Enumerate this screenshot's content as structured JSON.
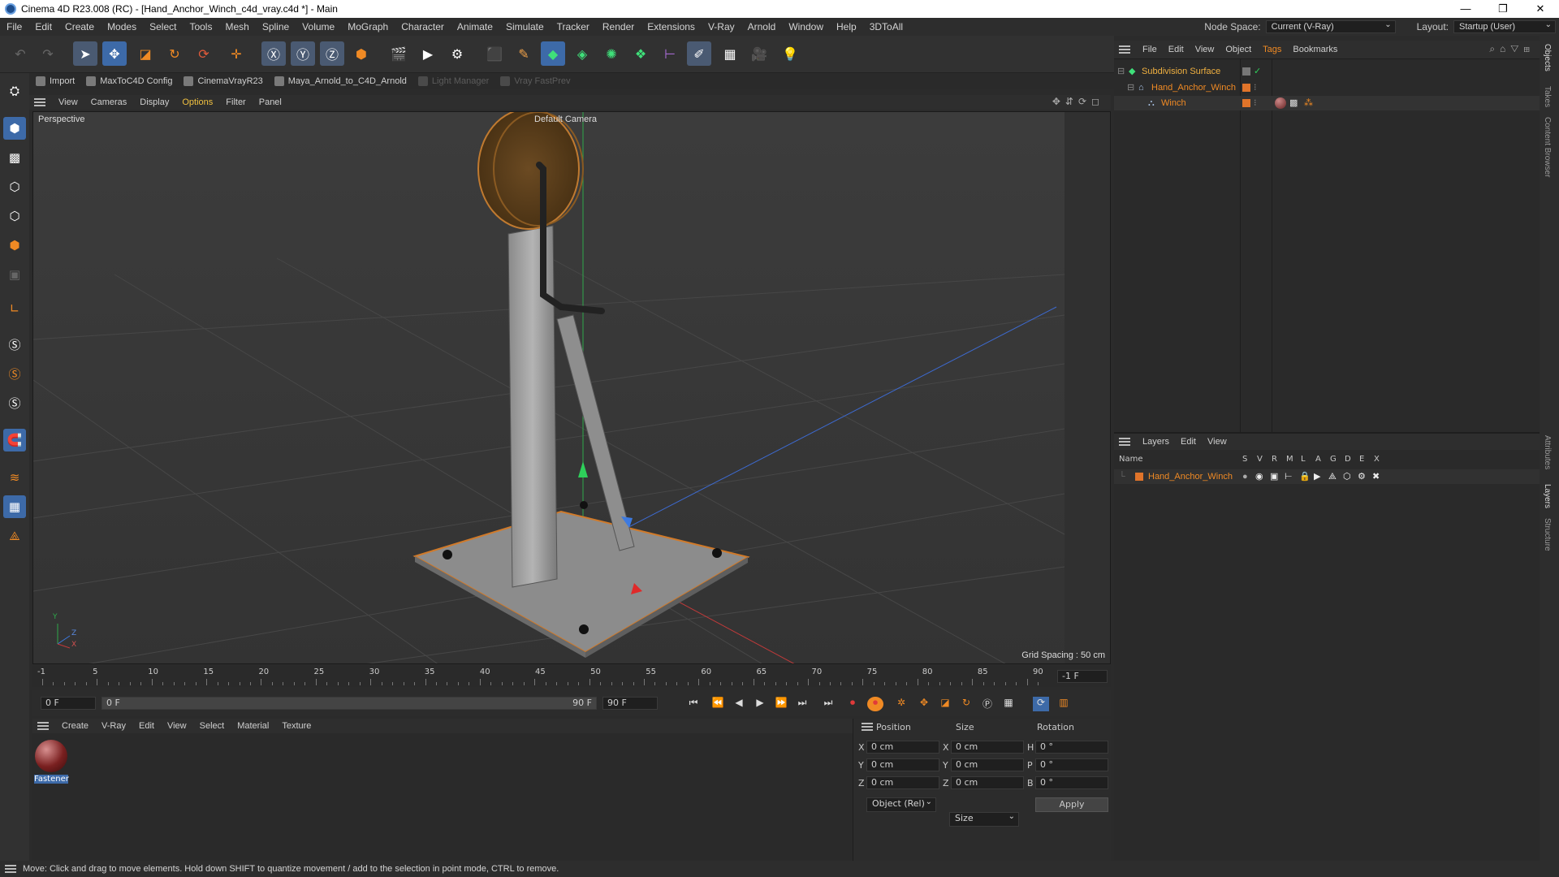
{
  "window": {
    "title": "Cinema 4D R23.008 (RC) - [Hand_Anchor_Winch_c4d_vray.c4d *] - Main",
    "controls": [
      "—",
      "❐",
      "✕"
    ]
  },
  "menubar": {
    "items": [
      "File",
      "Edit",
      "Create",
      "Modes",
      "Select",
      "Tools",
      "Mesh",
      "Spline",
      "Volume",
      "MoGraph",
      "Character",
      "Animate",
      "Simulate",
      "Tracker",
      "Render",
      "Extensions",
      "V-Ray",
      "Arnold",
      "Window",
      "Help",
      "3DToAll"
    ],
    "node_space_label": "Node Space:",
    "node_space_value": "Current (V-Ray)",
    "layout_label": "Layout:",
    "layout_value": "Startup (User)"
  },
  "pluginbar": {
    "items": [
      {
        "label": "Import",
        "enabled": true
      },
      {
        "label": "MaxToC4D Config",
        "enabled": true
      },
      {
        "label": "CinemaVrayR23",
        "enabled": true
      },
      {
        "label": "Maya_Arnold_to_C4D_Arnold",
        "enabled": true
      },
      {
        "label": "Light Manager",
        "enabled": false
      },
      {
        "label": "Vray FastPrev",
        "enabled": false
      }
    ]
  },
  "viewport": {
    "menu": [
      "View",
      "Cameras",
      "Display",
      "Options",
      "Filter",
      "Panel"
    ],
    "label": "Perspective",
    "camera": "Default Camera",
    "grid_spacing": "Grid Spacing : 50 cm",
    "axis_labels": {
      "y": "Y",
      "z": "Z",
      "x": "X"
    }
  },
  "timeline": {
    "ticks": [
      "-1",
      "5",
      "10",
      "15",
      "20",
      "25",
      "30",
      "35",
      "40",
      "45",
      "50",
      "55",
      "60",
      "65",
      "70",
      "75",
      "80",
      "85",
      "90"
    ],
    "current_frame_display": "-1 F",
    "start_field": "0 F",
    "range_start": "0 F",
    "range_end": "90 F",
    "end_field": "90 F"
  },
  "materials": {
    "menu": [
      "Create",
      "V-Ray",
      "Edit",
      "View",
      "Select",
      "Material",
      "Texture"
    ],
    "items": [
      {
        "name": "Fastener"
      }
    ]
  },
  "coordinates": {
    "headers": [
      "Position",
      "Size",
      "Rotation"
    ],
    "rows": [
      {
        "axis": "X",
        "pos": "0 cm",
        "size_axis": "X",
        "size": "0 cm",
        "rot_axis": "H",
        "rot": "0 °"
      },
      {
        "axis": "Y",
        "pos": "0 cm",
        "size_axis": "Y",
        "size": "0 cm",
        "rot_axis": "P",
        "rot": "0 °"
      },
      {
        "axis": "Z",
        "pos": "0 cm",
        "size_axis": "Z",
        "size": "0 cm",
        "rot_axis": "B",
        "rot": "0 °"
      }
    ],
    "mode_select": "Object (Rel)",
    "size_select": "Size",
    "apply_label": "Apply"
  },
  "objects": {
    "menu": [
      "File",
      "Edit",
      "View",
      "Object",
      "Tags",
      "Bookmarks"
    ],
    "tree": [
      {
        "name": "Subdivision Surface",
        "indent": 0,
        "color": "#f0a24a"
      },
      {
        "name": "Hand_Anchor_Winch",
        "indent": 1,
        "color": "#f08a24"
      },
      {
        "name": "Winch",
        "indent": 2,
        "color": "#f08a24"
      }
    ]
  },
  "layers": {
    "menu": [
      "Layers",
      "Edit",
      "View"
    ],
    "columns": [
      "Name",
      "S",
      "V",
      "R",
      "M",
      "L",
      "A",
      "G",
      "D",
      "E",
      "X"
    ],
    "rows": [
      {
        "name": "Hand_Anchor_Winch",
        "color": "#e0742a"
      }
    ]
  },
  "side_tabs": [
    "Objects",
    "Takes",
    "Content Browser",
    "Attributes",
    "Layers",
    "Structure"
  ],
  "status": {
    "text": "Move: Click and drag to move elements. Hold down SHIFT to quantize movement / add to the selection in point mode, CTRL to remove."
  },
  "colors": {
    "accent": "#f08a24",
    "selection_blue": "#3d6aa8",
    "background": "#2b2b2b"
  }
}
